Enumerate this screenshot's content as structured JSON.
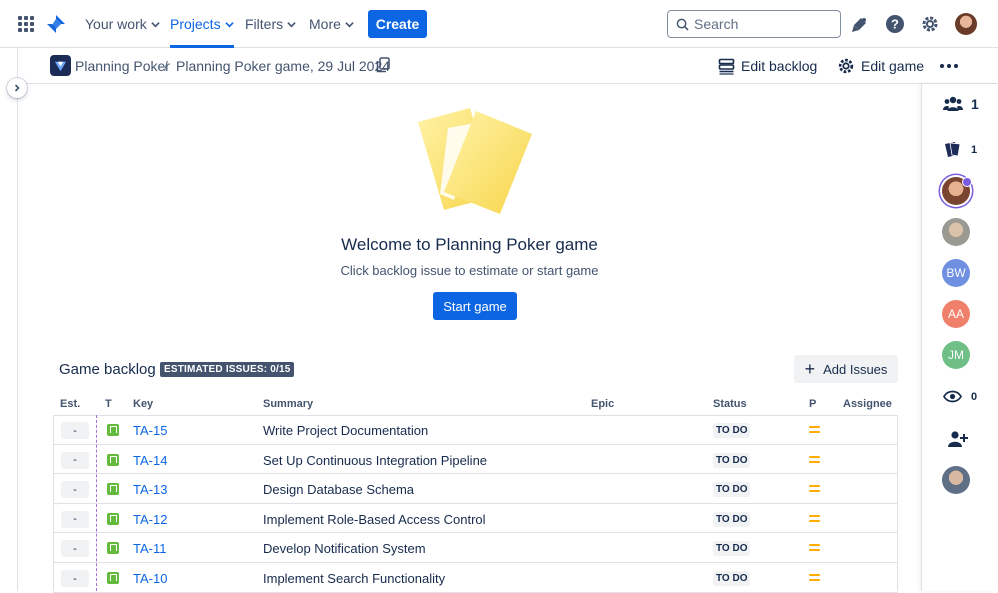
{
  "nav": {
    "your_work": "Your work",
    "projects": "Projects",
    "filters": "Filters",
    "more": "More",
    "create": "Create",
    "search_placeholder": "Search"
  },
  "breadcrumb": {
    "project": "Planning Poker",
    "game": "Planning Poker game, 29 Jul 2024"
  },
  "actions": {
    "edit_backlog": "Edit backlog",
    "edit_game": "Edit game"
  },
  "right_panel": {
    "participants_count": "1",
    "cards_count": "1",
    "spectators_count": "0",
    "avatars": [
      {
        "initials": "",
        "color": "#8a5a44"
      },
      {
        "initials": "",
        "color": "#b5b0a4"
      },
      {
        "initials": "BW",
        "color": "#6f8fe0"
      },
      {
        "initials": "AA",
        "color": "#f0806b"
      },
      {
        "initials": "JM",
        "color": "#6fbf87"
      }
    ]
  },
  "welcome": {
    "title": "Welcome to Planning Poker game",
    "hint": "Click backlog issue to estimate or start game",
    "start_button": "Start game"
  },
  "backlog": {
    "title": "Game backlog",
    "badge": "ESTIMATED ISSUES: 0/15",
    "add_issues": "Add Issues",
    "columns": {
      "est": "Est.",
      "type": "T",
      "key": "Key",
      "summary": "Summary",
      "epic": "Epic",
      "status": "Status",
      "priority": "P",
      "assignee": "Assignee"
    },
    "rows": [
      {
        "est": "-",
        "key": "TA-15",
        "summary": "Write Project Documentation",
        "status": "TO DO"
      },
      {
        "est": "-",
        "key": "TA-14",
        "summary": "Set Up Continuous Integration Pipeline",
        "status": "TO DO"
      },
      {
        "est": "-",
        "key": "TA-13",
        "summary": "Design Database Schema",
        "status": "TO DO"
      },
      {
        "est": "-",
        "key": "TA-12",
        "summary": "Implement Role-Based Access Control",
        "status": "TO DO"
      },
      {
        "est": "-",
        "key": "TA-11",
        "summary": "Develop Notification System",
        "status": "TO DO"
      },
      {
        "est": "-",
        "key": "TA-10",
        "summary": "Implement Search Functionality",
        "status": "TO DO"
      }
    ]
  },
  "colors": {
    "primary": "#0c66e4",
    "priority_medium": "#ffab00",
    "story_green": "#63ba3c"
  }
}
